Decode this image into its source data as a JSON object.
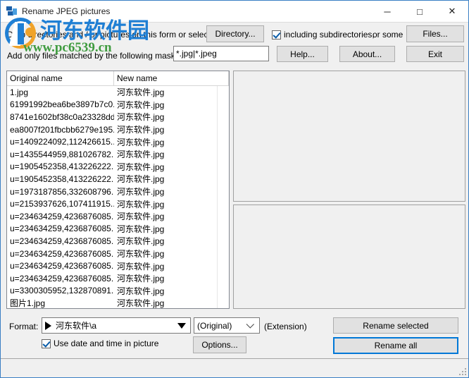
{
  "window": {
    "title": "Rename JPEG pictures",
    "icon": "app-icon",
    "minimize_label": "─",
    "maximize_label": "□",
    "close_label": "✕"
  },
  "watermark": {
    "site_name": "河东软件园",
    "url": "www.pc6539.cn"
  },
  "toolbar": {
    "drop_hint": "Drop directories and / or pictures on this form or select a",
    "directory_button": "Directory...",
    "include_subdirectories_label": "including subdirectories,",
    "include_subdirectories_checked": true,
    "or_some_label": "or some",
    "files_button": "Files...",
    "mask_label": "Add only files matched by the following mask(s) :",
    "mask_value": "*.jpg|*.jpeg",
    "help_button": "Help...",
    "about_button": "About...",
    "exit_button": "Exit"
  },
  "filelist": {
    "columns": [
      "Original name",
      "New name"
    ],
    "rows": [
      {
        "original": "1.jpg",
        "new": "河东软件.jpg"
      },
      {
        "original": "61991992bea6be3897b7c0...",
        "new": "河东软件.jpg"
      },
      {
        "original": "8741e1602bf38c0a23328dd...",
        "new": "河东软件.jpg"
      },
      {
        "original": "ea8007f201fbcbb6279e195...",
        "new": "河东软件.jpg"
      },
      {
        "original": "u=1409224092,112426615...",
        "new": "河东软件.jpg"
      },
      {
        "original": "u=1435544959,881026782...",
        "new": "河东软件.jpg"
      },
      {
        "original": "u=1905452358,413226222...",
        "new": "河东软件.jpg"
      },
      {
        "original": "u=1905452358,413226222...",
        "new": "河东软件.jpg"
      },
      {
        "original": "u=1973187856,332608796...",
        "new": "河东软件.jpg"
      },
      {
        "original": "u=2153937626,107411915...",
        "new": "河东软件.jpg"
      },
      {
        "original": "u=234634259,4236876085...",
        "new": "河东软件.jpg"
      },
      {
        "original": "u=234634259,4236876085...",
        "new": "河东软件.jpg"
      },
      {
        "original": "u=234634259,4236876085...",
        "new": "河东软件.jpg"
      },
      {
        "original": "u=234634259,4236876085...",
        "new": "河东软件.jpg"
      },
      {
        "original": "u=234634259,4236876085...",
        "new": "河东软件.jpg"
      },
      {
        "original": "u=234634259,4236876085...",
        "new": "河东软件.jpg"
      },
      {
        "original": "u=3300305952,132870891...",
        "new": "河东软件.jpg"
      },
      {
        "original": "图片1.jpg",
        "new": "河东软件.jpg"
      }
    ]
  },
  "bottom": {
    "format_label": "Format:",
    "format_value": "河东软件\\a",
    "extension_value": "(Original)",
    "extension_label": "(Extension)",
    "use_datetime_label": "Use date and time in picture",
    "use_datetime_checked": true,
    "options_button": "Options...",
    "rename_selected_button": "Rename selected",
    "rename_all_button": "Rename all"
  },
  "statusbar": {
    "text": ""
  },
  "colors": {
    "window_border": "#3a7fc4",
    "focus_accent": "#0078d7",
    "face": "#f0f0f0",
    "button_face": "#e1e1e1",
    "watermark_blue": "#1f7fd4",
    "watermark_green": "#3f9b3f"
  }
}
